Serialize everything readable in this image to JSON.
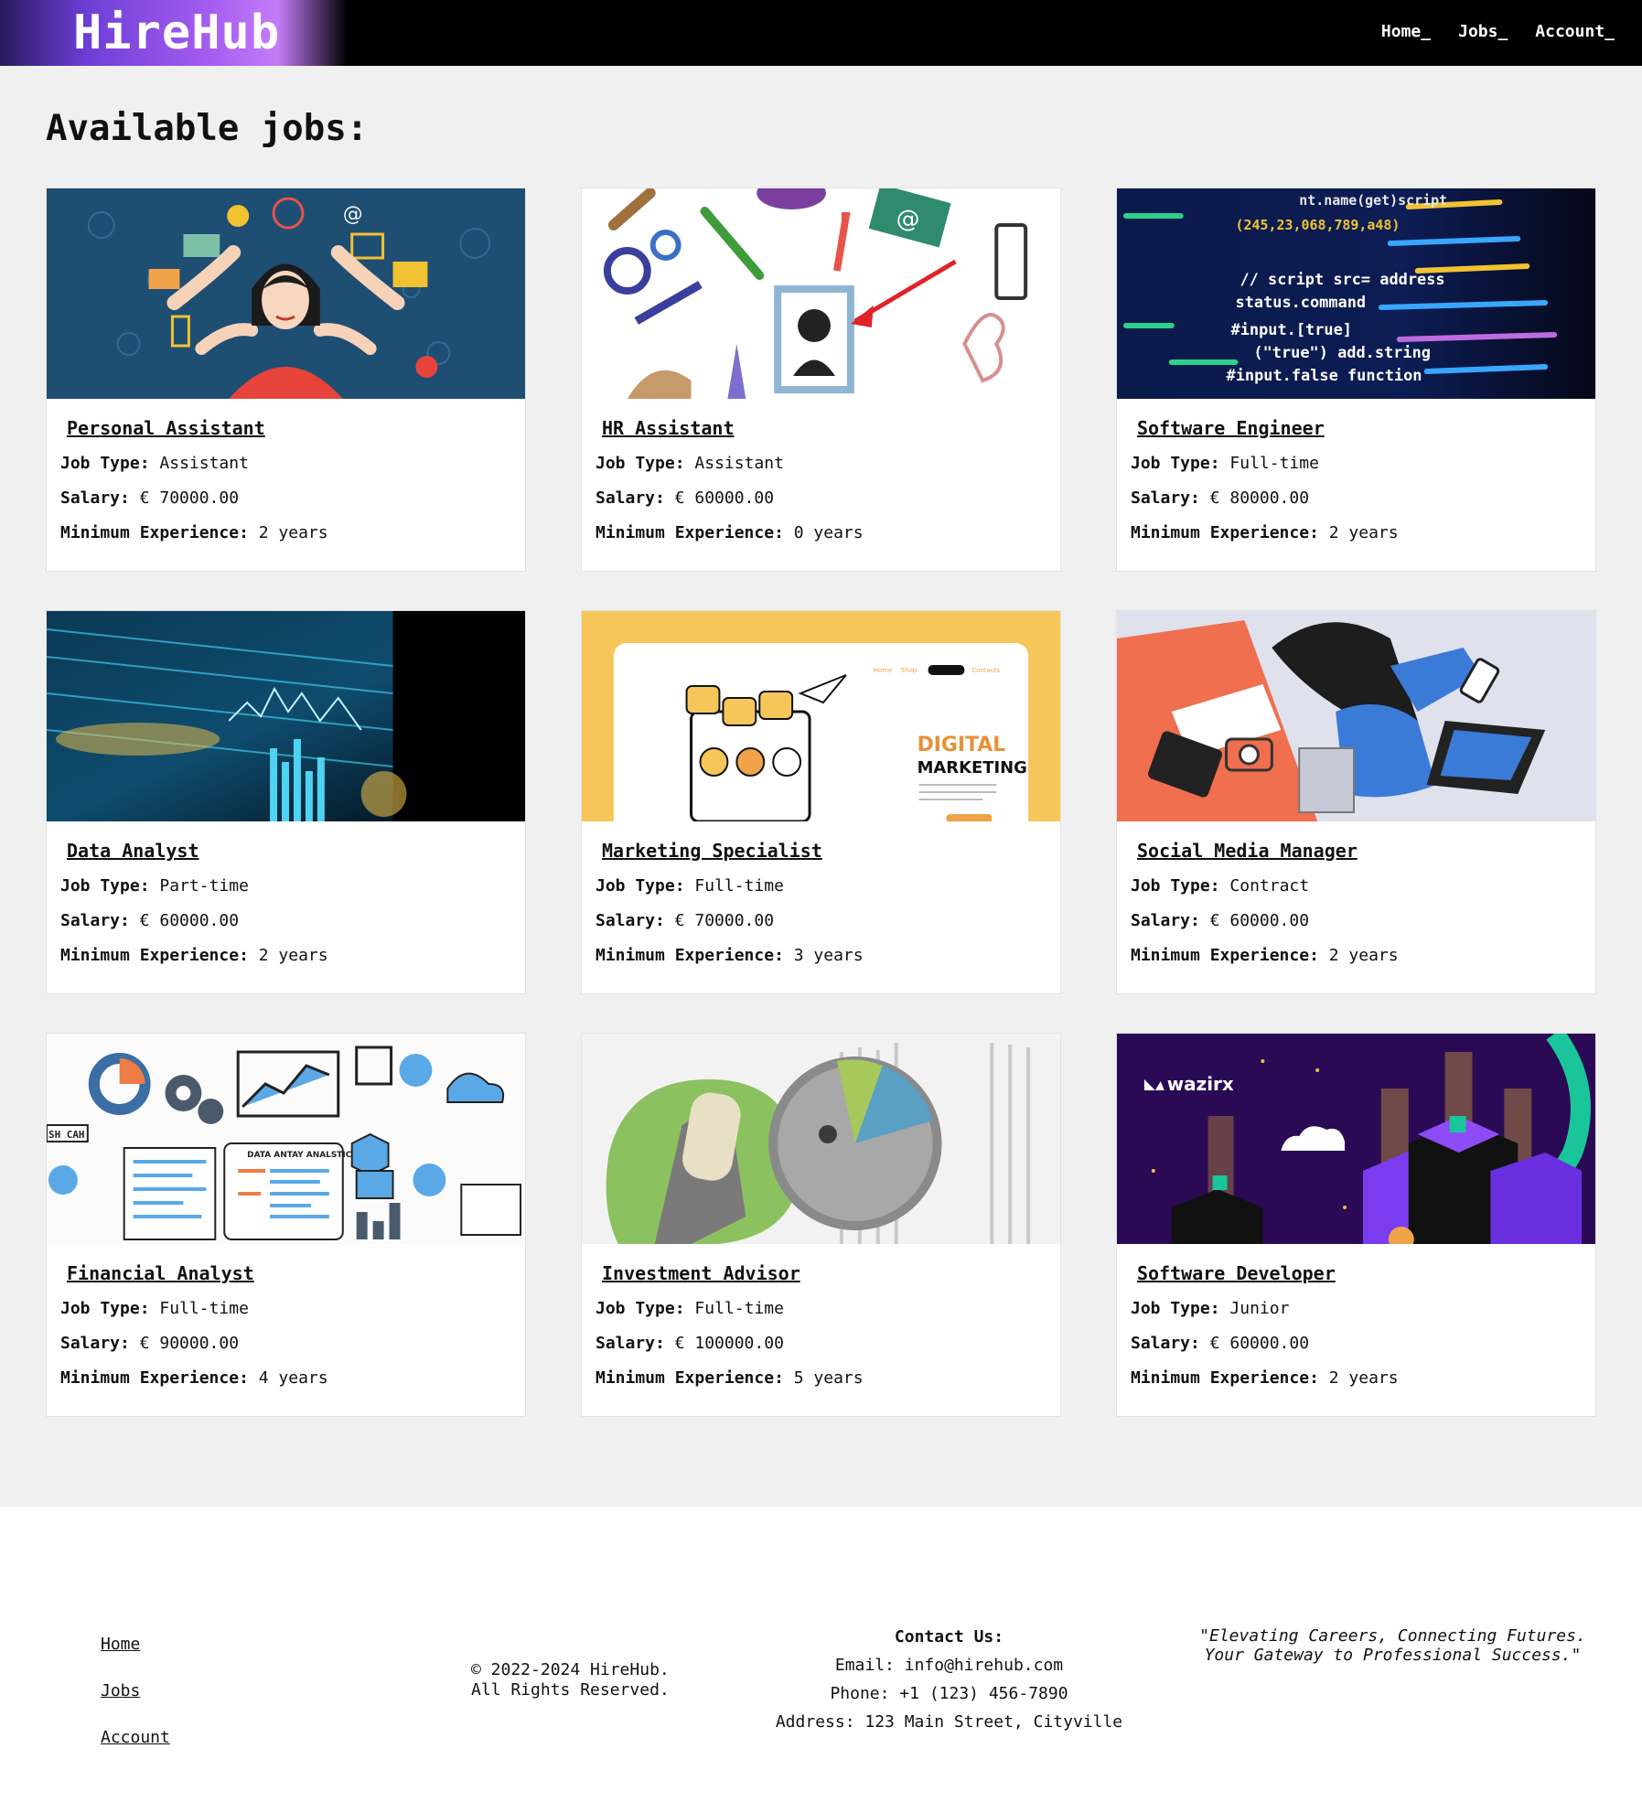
{
  "header": {
    "brand": "HireHub",
    "nav": [
      "Home_",
      "Jobs_",
      "Account_"
    ]
  },
  "page_title": "Available jobs:",
  "labels": {
    "job_type": "Job Type:",
    "salary": "Salary:",
    "min_exp": "Minimum Experience:"
  },
  "jobs": [
    {
      "title": "Personal Assistant",
      "type": "Assistant",
      "salary": "€ 70000.00",
      "experience": "2 years",
      "image": "multitasking-assistant-illustration"
    },
    {
      "title": "HR Assistant",
      "type": "Assistant",
      "salary": "€ 60000.00",
      "experience": "0 years",
      "image": "hr-doodle-illustration"
    },
    {
      "title": "Software Engineer",
      "type": "Full-time",
      "salary": "€ 80000.00",
      "experience": "2 years",
      "image": "code-screen-photo"
    },
    {
      "title": "Data Analyst",
      "type": "Part-time",
      "salary": "€ 60000.00",
      "experience": "2 years",
      "image": "data-chart-photo"
    },
    {
      "title": "Marketing Specialist",
      "type": "Full-time",
      "salary": "€ 70000.00",
      "experience": "3 years",
      "image": "digital-marketing-illustration"
    },
    {
      "title": "Social Media Manager",
      "type": "Contract",
      "salary": "€ 60000.00",
      "experience": "2 years",
      "image": "social-media-illustration"
    },
    {
      "title": "Financial Analyst",
      "type": "Full-time",
      "salary": "€ 90000.00",
      "experience": "4 years",
      "image": "finance-icons-illustration"
    },
    {
      "title": "Investment Advisor",
      "type": "Full-time",
      "salary": "€ 100000.00",
      "experience": "5 years",
      "image": "investment-collage"
    },
    {
      "title": "Software Developer",
      "type": "Junior",
      "salary": "€ 60000.00",
      "experience": "2 years",
      "image": "wazirx-illustration"
    }
  ],
  "image_text": {
    "dm_title_1": "DIGITAL",
    "dm_title_2": "MARKETING",
    "fin_label_1": "DATA ANTAY ANALSTIC",
    "fin_label_2": "SH CAH",
    "wazirx_logo": "wazirx"
  },
  "footer": {
    "links": [
      "Home",
      "Jobs",
      "Account"
    ],
    "copyright_1": "© 2022-2024 HireHub.",
    "copyright_2": "All Rights Reserved.",
    "contact_heading": "Contact Us:",
    "email": "Email: info@hirehub.com",
    "phone": "Phone: +1 (123) 456-7890",
    "address": "Address: 123 Main Street, Cityville",
    "quote": "\"Elevating Careers, Connecting Futures. Your Gateway to Professional Success.\""
  },
  "colors": {
    "brand_gradient": [
      "#2a1a5e",
      "#6d3fd6",
      "#c47cf7"
    ],
    "background": "#f0f0f0",
    "header": "#000000"
  }
}
